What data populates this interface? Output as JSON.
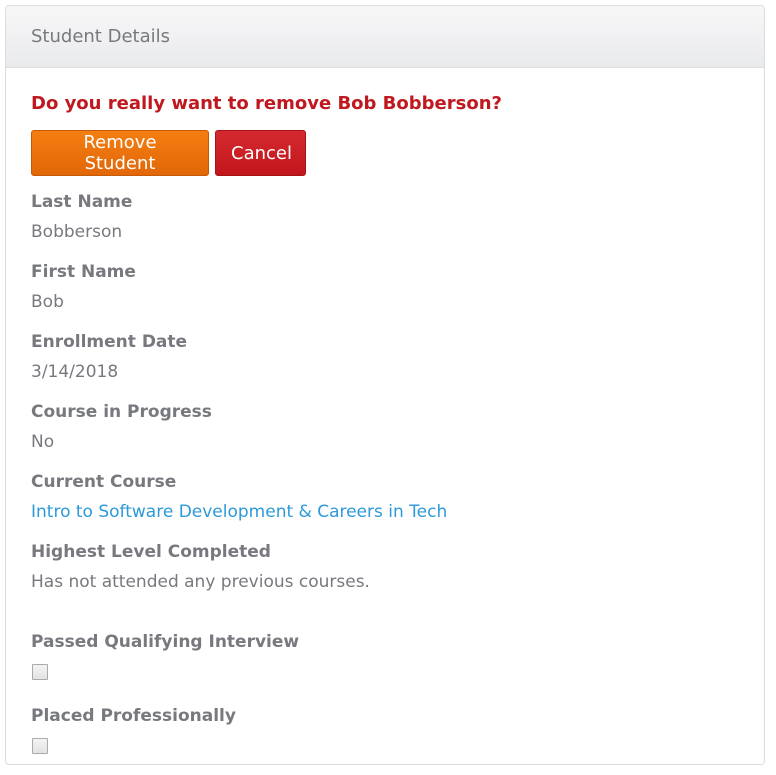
{
  "panel": {
    "title": "Student Details"
  },
  "confirm": {
    "message": "Do you really want to remove Bob Bobberson?",
    "remove_label": "Remove Student",
    "cancel_label": "Cancel"
  },
  "fields": {
    "last_name": {
      "label": "Last Name",
      "value": "Bobberson"
    },
    "first_name": {
      "label": "First Name",
      "value": "Bob"
    },
    "enrollment_date": {
      "label": "Enrollment Date",
      "value": "3/14/2018"
    },
    "course_in_progress": {
      "label": "Course in Progress",
      "value": "No"
    },
    "current_course": {
      "label": "Current Course",
      "value": "Intro to Software Development & Careers in Tech"
    },
    "highest_level": {
      "label": "Highest Level Completed",
      "value": "Has not attended any previous courses."
    },
    "passed_interview": {
      "label": "Passed Qualifying Interview",
      "checked": false
    },
    "placed_professionally": {
      "label": "Placed Professionally",
      "checked": false
    }
  },
  "colors": {
    "danger_text": "#c0181f",
    "remove_button": "#f47e11",
    "cancel_button": "#c2161c",
    "link": "#2c9ad7",
    "muted_text": "#77797e"
  }
}
